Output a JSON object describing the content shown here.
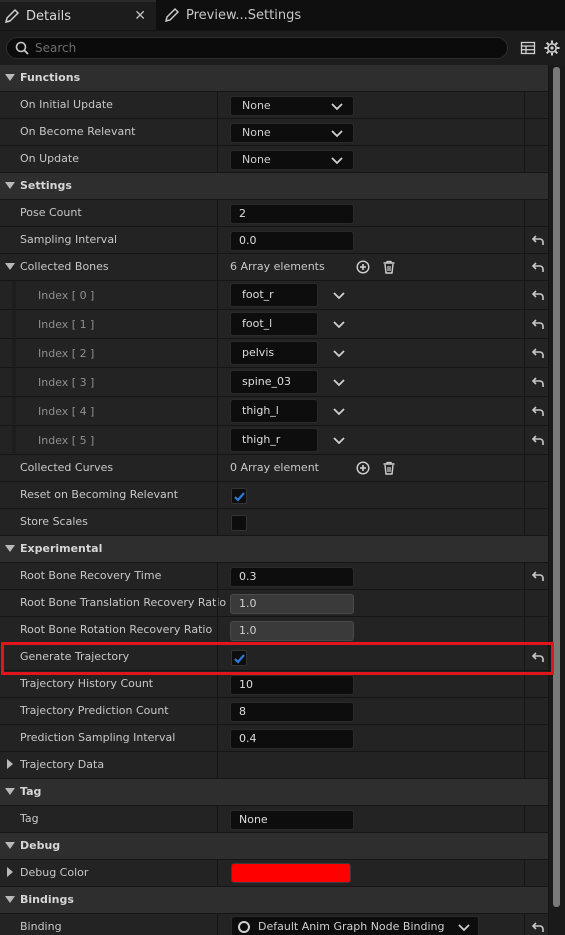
{
  "tabs": [
    {
      "label": "Details",
      "icon": "pencil-icon",
      "active": true
    },
    {
      "label": "Preview...Settings",
      "icon": "pencil-icon",
      "active": false
    }
  ],
  "search": {
    "placeholder": "Search"
  },
  "functions": {
    "title": "Functions",
    "on_initial_update": {
      "label": "On Initial Update",
      "value": "None"
    },
    "on_become_relevant": {
      "label": "On Become Relevant",
      "value": "None"
    },
    "on_update": {
      "label": "On Update",
      "value": "None"
    }
  },
  "settings": {
    "title": "Settings",
    "pose_count": {
      "label": "Pose Count",
      "value": "2"
    },
    "sampling_interval": {
      "label": "Sampling Interval",
      "value": "0.0"
    },
    "collected_bones": {
      "label": "Collected Bones",
      "summary": "6 Array elements",
      "items": [
        {
          "label": "Index [ 0 ]",
          "value": "foot_r"
        },
        {
          "label": "Index [ 1 ]",
          "value": "foot_l"
        },
        {
          "label": "Index [ 2 ]",
          "value": "pelvis"
        },
        {
          "label": "Index [ 3 ]",
          "value": "spine_03"
        },
        {
          "label": "Index [ 4 ]",
          "value": "thigh_l"
        },
        {
          "label": "Index [ 5 ]",
          "value": "thigh_r"
        }
      ]
    },
    "collected_curves": {
      "label": "Collected Curves",
      "summary": "0 Array element"
    },
    "reset_on_becoming_relevant": {
      "label": "Reset on Becoming Relevant",
      "checked": true
    },
    "store_scales": {
      "label": "Store Scales",
      "checked": false
    }
  },
  "experimental": {
    "title": "Experimental",
    "root_bone_recovery_time": {
      "label": "Root Bone Recovery Time",
      "value": "0.3"
    },
    "root_bone_translation_recovery_ratio": {
      "label": "Root Bone Translation Recovery Ratio",
      "value": "1.0"
    },
    "root_bone_rotation_recovery_ratio": {
      "label": "Root Bone Rotation Recovery Ratio",
      "value": "1.0"
    },
    "generate_trajectory": {
      "label": "Generate Trajectory",
      "checked": true
    },
    "trajectory_history_count": {
      "label": "Trajectory History Count",
      "value": "10"
    },
    "trajectory_prediction_count": {
      "label": "Trajectory Prediction Count",
      "value": "8"
    },
    "prediction_sampling_interval": {
      "label": "Prediction Sampling Interval",
      "value": "0.4"
    },
    "trajectory_data": {
      "label": "Trajectory Data"
    }
  },
  "tag": {
    "title": "Tag",
    "tag": {
      "label": "Tag",
      "value": "None"
    }
  },
  "debug": {
    "title": "Debug",
    "debug_color": {
      "label": "Debug Color",
      "color": "#ff0000"
    }
  },
  "bindings": {
    "title": "Bindings",
    "binding": {
      "label": "Binding",
      "value": "Default Anim Graph Node Binding"
    }
  },
  "colors": {
    "highlight": "#e0161c",
    "checkbox_accent": "#2f7bd8"
  }
}
